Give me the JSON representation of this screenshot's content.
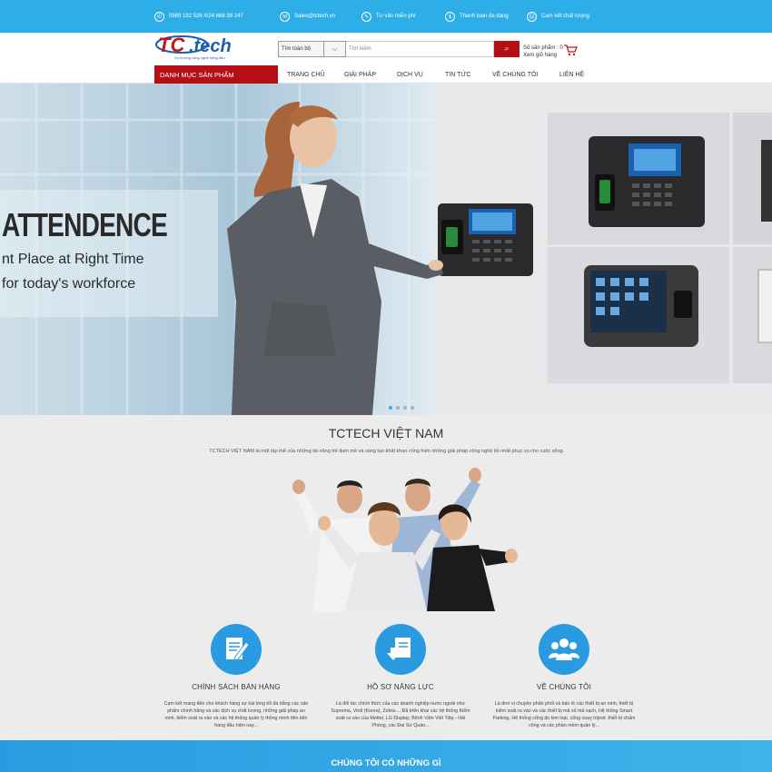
{
  "topbar": {
    "phone": "0989 192 526 /024 668 39 247",
    "email": "Sales@tctech.vn",
    "advice": "Tư vấn miễn phí",
    "payment": "Thanh toán đa dạng",
    "quality": "Cam kết chất lượng"
  },
  "logo": {
    "text": "TC.tech",
    "slogan": "Xu hướng công nghệ hàng đầu"
  },
  "search": {
    "category": "Tìm toàn bộ",
    "placeholder": "Tìm kiếm"
  },
  "cart": {
    "count_label": "Số sản phẩm : 0",
    "view_label": "Xem giỏ hàng"
  },
  "nav": {
    "category_label": "DANH MỤC SẢN PHẨM",
    "items": [
      "TRANG CHỦ",
      "GIẢI PHÁP",
      "DỊCH VỤ",
      "TIN TỨC",
      "VỀ CHÚNG TÔI",
      "LIÊN HỆ"
    ]
  },
  "hero": {
    "headline": "ATTENDENCE",
    "line1": "nt Place at Right Time",
    "line2": "for today's workforce",
    "slide_active": 0,
    "slide_count": 4
  },
  "about": {
    "title": "TCTECH VIỆT NAM",
    "desc": "TCTECH VIỆT NAM là một tập thể của những tài năng trẻ đam mê và sáng tạo khát khao cống hiến những giải pháp công nghệ tối nhất phục vụ cho cuộc sống"
  },
  "features": [
    {
      "title": "CHÍNH SÁCH BÁN HÀNG",
      "desc": "Cam kết mang đến cho khách hàng sự hài lòng tối đa bằng các sản phẩm chính hãng và các dịch vụ chất lượng, những giải pháp an ninh, kiểm soát ra vào và các hệ thống quản lý thông minh tiên tiến hàng đầu hiện nay...",
      "icon": "document-pen-icon"
    },
    {
      "title": "HỒ SƠ NĂNG LỰC",
      "desc": "Là đối tác chính thức của các doanh nghiệp nước ngoài như Suprema, Virdi (Korea), Zebra.... Đã triển khai các hệ thống Kiểm soát ra vào của Mettel, LG Display, Bệnh Viện Việt Tiệp - Hải Phòng, các Đại Sứ Quán...",
      "icon": "document-download-icon"
    },
    {
      "title": "VỀ CHÚNG TÔI",
      "desc": "Là đơn vị chuyên phân phối và bán lẻ các thiết bị an ninh, thiết bị kiểm soát ra vào và các thiết bị mã số mã vạch, Hệ thống Smart Parking, Hệ thống cổng đo kim loại, cổng xoay tripod, thiết bị chấm công và các phần mềm quản lý...",
      "icon": "people-group-icon"
    }
  ],
  "bottom": {
    "title": "CHÚNG TÔI CÓ NHỮNG GÌ"
  },
  "colors": {
    "accent": "#2eaee6",
    "brand_red": "#b50f16",
    "feature_blue": "#2a9be0"
  }
}
